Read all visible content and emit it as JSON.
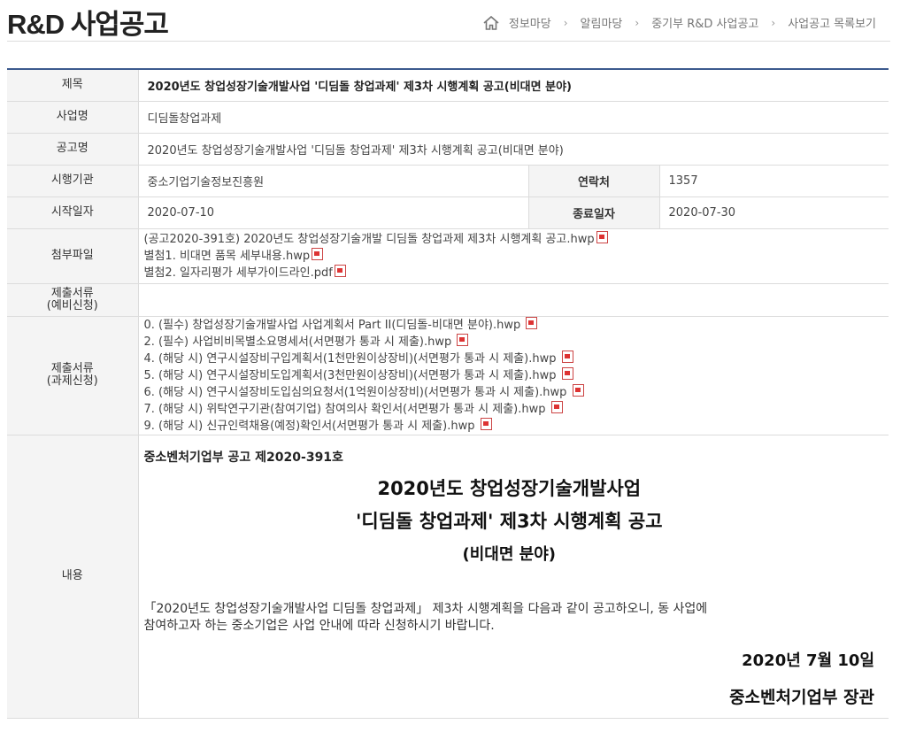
{
  "page": {
    "title": "R&D 사업공고"
  },
  "breadcrumb": [
    "정보마당",
    "알림마당",
    "중기부 R&D 사업공고",
    "사업공고 목록보기"
  ],
  "detail": {
    "title_label": "제목",
    "title_value": "2020년도 창업성장기술개발사업 '디딤돌 창업과제' 제3차 시행계획 공고(비대면 분야)",
    "program_label": "사업명",
    "program_value": "디딤돌창업과제",
    "notice_label": "공고명",
    "notice_value": "2020년도 창업성장기술개발사업 '디딤돌 창업과제' 제3차 시행계획 공고(비대면 분야)",
    "agency_label": "시행기관",
    "agency_value": "중소기업기술정보진흥원",
    "contact_label": "연락처",
    "contact_value": "1357",
    "start_label": "시작일자",
    "start_value": "2020-07-10",
    "end_label": "종료일자",
    "end_value": "2020-07-30",
    "attach_label": "첨부파일",
    "attachments": [
      "(공고2020-391호) 2020년도 창업성장기술개발 디딤돌 창업과제 제3차 시행계획 공고.hwp",
      "별첨1. 비대면 품목 세부내용.hwp",
      "별첨2. 일자리평가 세부가이드라인.pdf"
    ],
    "docs_pre_label": "제출서류\n(예비신청)",
    "docs_task_label": "제출서류\n(과제신청)",
    "docs_task": [
      "0. (필수) 창업성장기술개발사업 사업계획서 Part II(디딤돌-비대면 분야).hwp",
      "2. (필수) 사업비비목별소요명세서(서면평가 통과 시 제출).hwp",
      "4. (해당 시) 연구시설장비구입계획서(1천만원이상장비)(서면평가 통과 시 제출).hwp",
      "5. (해당 시) 연구시설장비도입계획서(3천만원이상장비)(서면평가 통과 시 제출).hwp",
      "6. (해당 시) 연구시설장비도입심의요청서(1억원이상장비)(서면평가 통과 시 제출).hwp",
      "7. (해당 시) 위탁연구기관(참여기업) 참여의사 확인서(서면평가 통과 시 제출).hwp",
      "9. (해당 시) 신규인력채용(예정)확인서(서면평가 통과 시 제출).hwp"
    ],
    "content_label": "내용"
  },
  "content": {
    "notice_no": "중소벤처기업부 공고 제2020-391호",
    "headline1": "2020년도 창업성장기술개발사업",
    "headline2": "'디딤돌 창업과제' 제3차 시행계획 공고",
    "headline3": "(비대면 분야)",
    "body_line1": "「2020년도 창업성장기술개발사업 디딤돌 창업과제」 제3차 시행계획을 다음과 같이 공고하오니, 동 사업에",
    "body_line2": "참여하고자 하는 중소기업은 사업 안내에 따라 신청하시기 바랍니다.",
    "date": "2020년 7월 10일",
    "signature": "중소벤처기업부 장관"
  }
}
